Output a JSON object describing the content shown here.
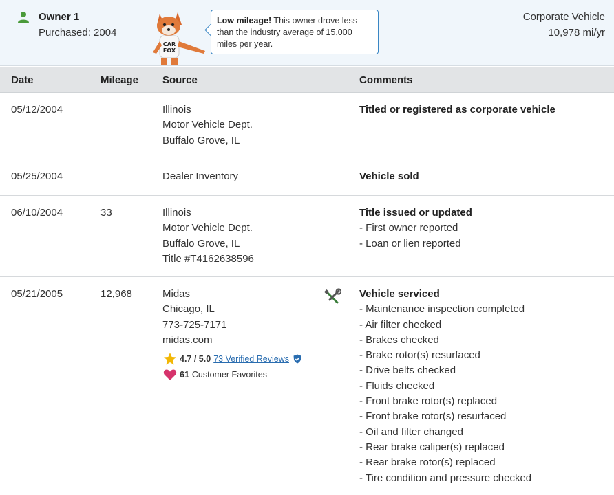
{
  "owner": {
    "name": "Owner 1",
    "purchased": "Purchased: 2004",
    "tip_bold": "Low mileage!",
    "tip_text": " This owner drove less than the industry average of 15,000 miles per year.",
    "vehicle_type": "Corporate Vehicle",
    "rate": "10,978 mi/yr"
  },
  "columns": {
    "date": "Date",
    "mileage": "Mileage",
    "source": "Source",
    "comments": "Comments"
  },
  "rows": [
    {
      "date": "05/12/2004",
      "mileage": "",
      "source": [
        "Illinois",
        "Motor Vehicle Dept.",
        "Buffalo Grove, IL"
      ],
      "title": "Titled or registered as corporate vehicle",
      "details": []
    },
    {
      "date": "05/25/2004",
      "mileage": "",
      "source": [
        "Dealer Inventory"
      ],
      "title": "Vehicle sold",
      "details": []
    },
    {
      "date": "06/10/2004",
      "mileage": "33",
      "source": [
        "Illinois",
        "Motor Vehicle Dept.",
        "Buffalo Grove, IL",
        "Title #T4162638596"
      ],
      "title": "Title issued or updated",
      "details": [
        "- First owner reported",
        "- Loan or lien reported"
      ]
    },
    {
      "date": "05/21/2005",
      "mileage": "12,968",
      "source": [
        "Midas",
        "Chicago, IL",
        "773-725-7171",
        "midas.com"
      ],
      "title": "Vehicle serviced",
      "details": [
        "- Maintenance inspection completed",
        "- Air filter checked",
        "- Brakes checked",
        "- Brake rotor(s) resurfaced",
        "- Drive belts checked",
        "- Fluids checked",
        "- Front brake rotor(s) replaced",
        "- Front brake rotor(s) resurfaced",
        "- Oil and filter changed",
        "- Rear brake caliper(s) replaced",
        "- Rear brake rotor(s) replaced",
        "- Tire condition and pressure checked"
      ]
    }
  ],
  "midas": {
    "rating": "4.7 / 5.0",
    "reviews": "73 Verified Reviews",
    "favorites_count": "61",
    "favorites_label": "Customer Favorites"
  },
  "fox_text": "CAR FOX",
  "colors": {
    "header_bg": "#f0f6fb",
    "table_head_bg": "#e2e4e6",
    "link": "#2a6db0",
    "bubble_border": "#3a86c4",
    "owner_icon": "#4a9a3a",
    "heart": "#d6336c",
    "star": "#f2b705"
  },
  "icons": {
    "owner": "person-icon",
    "service": "tools-icon",
    "rating": "star-icon",
    "verified": "verified-check-icon",
    "favorite": "heart-icon",
    "mascot": "carfox-mascot-icon"
  }
}
